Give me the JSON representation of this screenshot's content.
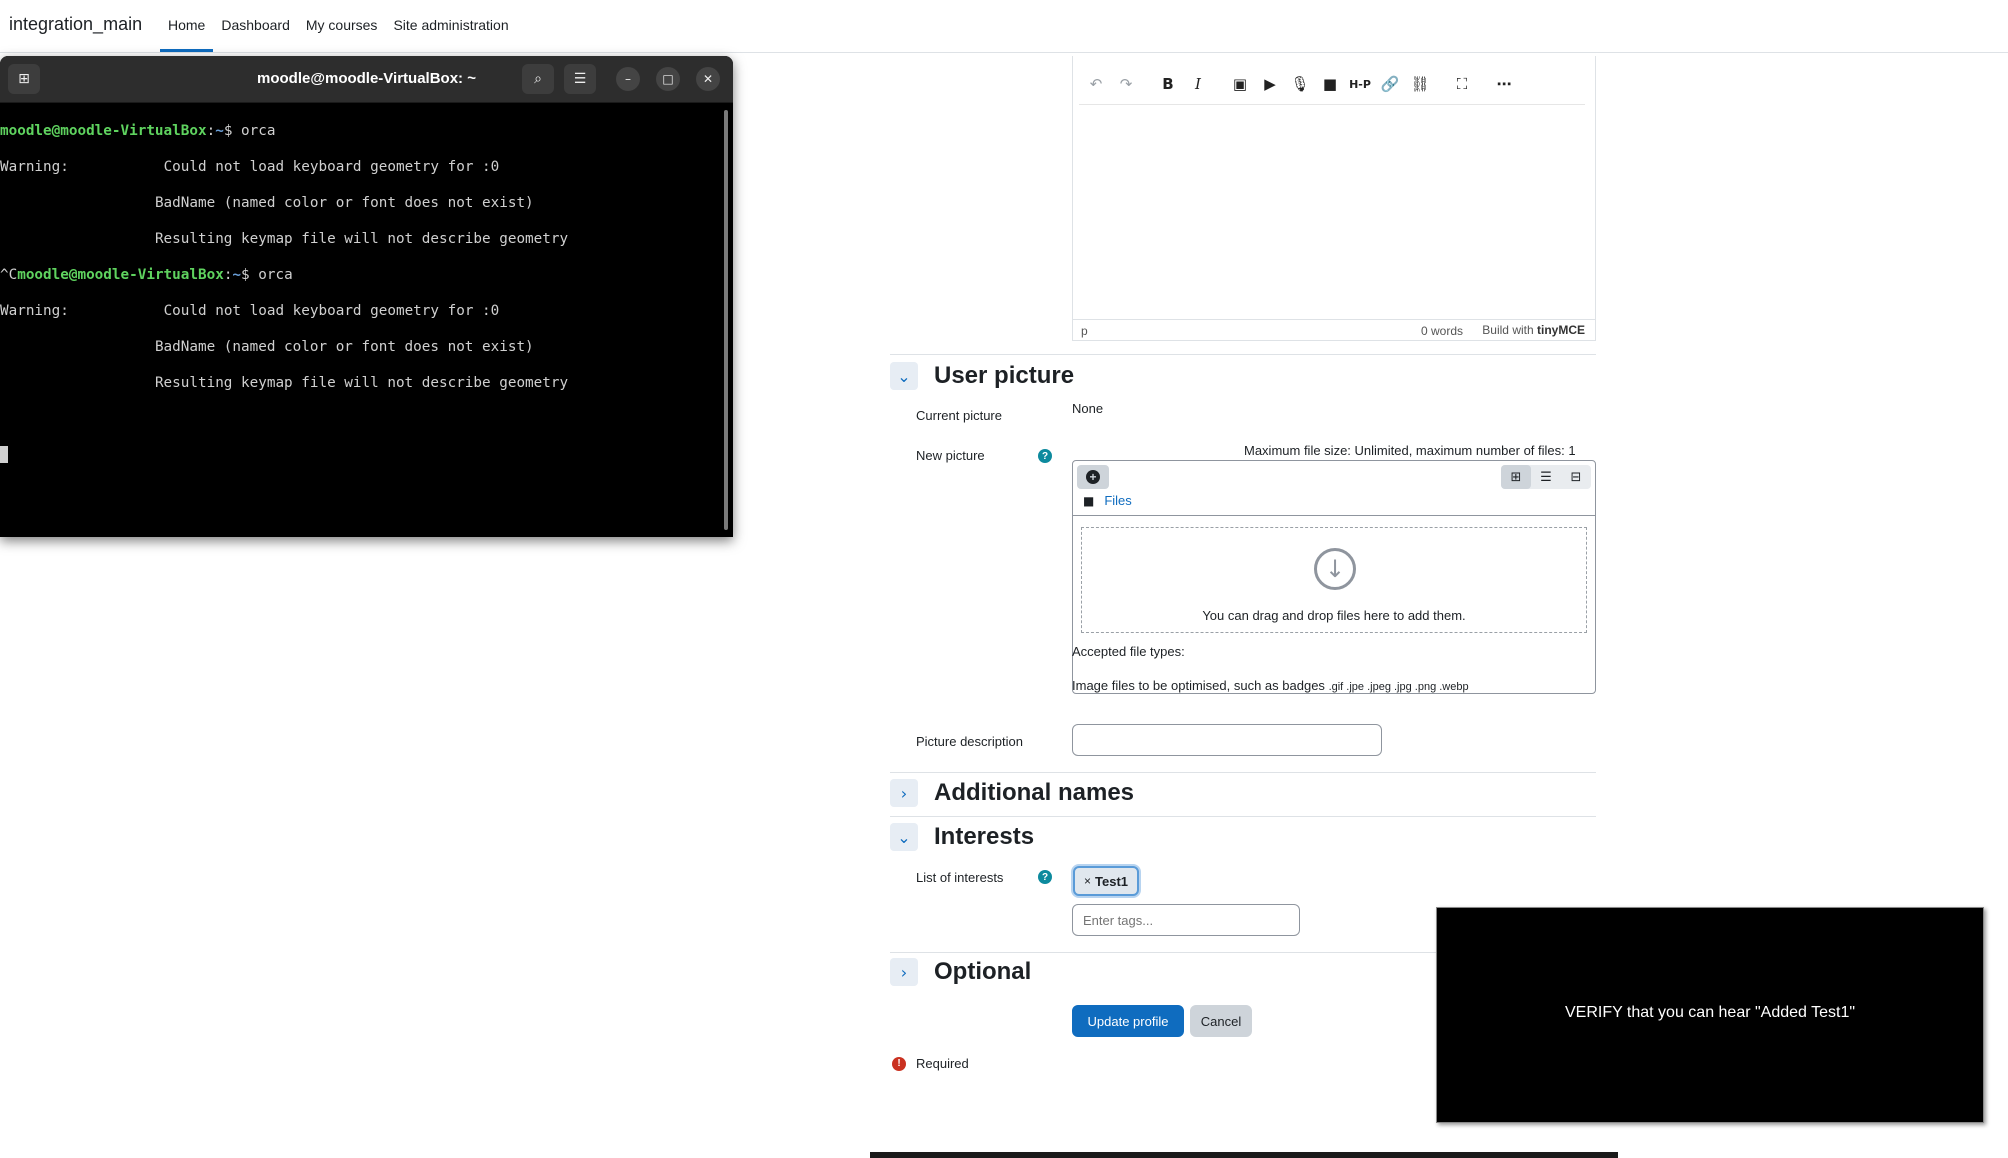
{
  "header": {
    "site_name": "integration_main",
    "nav": [
      "Home",
      "Dashboard",
      "My courses",
      "Site administration"
    ]
  },
  "editor": {
    "status_path": "p",
    "word_count": "0 words",
    "build_with": "Build with",
    "brand": "tinyMCE"
  },
  "user_picture": {
    "section_title": "User picture",
    "current_picture_label": "Current picture",
    "current_picture_value": "None",
    "new_picture_label": "New picture",
    "max_file_info": "Maximum file size: Unlimited, maximum number of files: 1",
    "files_link": "Files",
    "drop_text": "You can drag and drop files here to add them.",
    "accepted_types_label": "Accepted file types:",
    "accepted_types_desc": "Image files to be optimised, such as badges",
    "accepted_types_ext": ".gif .jpe .jpeg .jpg .png .webp",
    "picture_description_label": "Picture description",
    "picture_description_value": ""
  },
  "additional_names": {
    "section_title": "Additional names"
  },
  "interests": {
    "section_title": "Interests",
    "list_label": "List of interests",
    "tags": [
      "Test1"
    ],
    "tag_placeholder": "Enter tags..."
  },
  "optional": {
    "section_title": "Optional"
  },
  "actions": {
    "update": "Update profile",
    "cancel": "Cancel"
  },
  "required_text": "Required",
  "terminal": {
    "title": "moodle@moodle-VirtualBox: ~",
    "user_host": "moodle@moodle-VirtualBox",
    "path": "~",
    "command": "orca",
    "interrupt_prefix": "^C",
    "warning_label": "Warning:",
    "warning_lines": [
      "Could not load keyboard geometry for :0",
      "BadName (named color or font does not exist)",
      "Resulting keymap file will not describe geometry"
    ]
  },
  "verify_overlay": {
    "text": "VERIFY that you can hear \"Added Test1\""
  }
}
